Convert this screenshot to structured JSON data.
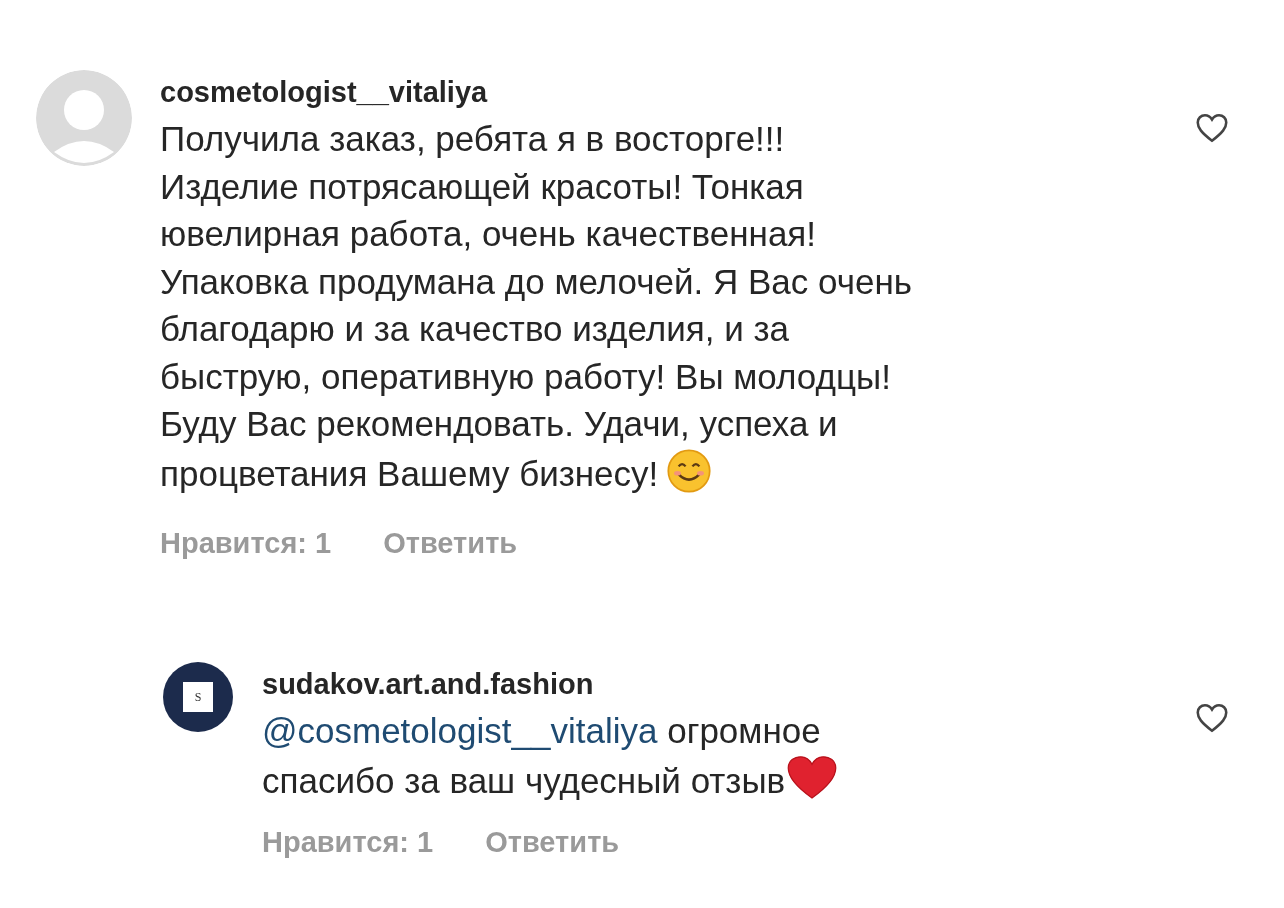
{
  "comments": [
    {
      "username": "cosmetologist__vitaliya",
      "avatar": {
        "kind": "default"
      },
      "lines": [
        "Получила заказ, ребята я в восторге!!!",
        "Изделие потрясающей красоты! Тонкая",
        "ювелирная работа, очень качественная!",
        "Упаковка продумана до мелочей. Я Вас очень",
        "благодарю и за качество изделия, и за",
        "быструю, оперативную работу! Вы молодцы!",
        "Буду Вас рекомендовать. Удачи, успеха и",
        "процветания Вашему бизнесу!"
      ],
      "emoji": {
        "kind": "smile"
      },
      "likes": "Нравится: 1",
      "reply": "Ответить",
      "liked": false
    },
    {
      "username": "sudakov.art.and.fashion",
      "avatar": {
        "kind": "logo",
        "letter": "S"
      },
      "mention": "@cosmetologist__vitaliya",
      "lines": [
        "огромное",
        "спасибо за ваш чудесный отзыв"
      ],
      "emoji": {
        "kind": "heart"
      },
      "likes": "Нравится: 1",
      "reply": "Ответить",
      "liked": false
    }
  ]
}
